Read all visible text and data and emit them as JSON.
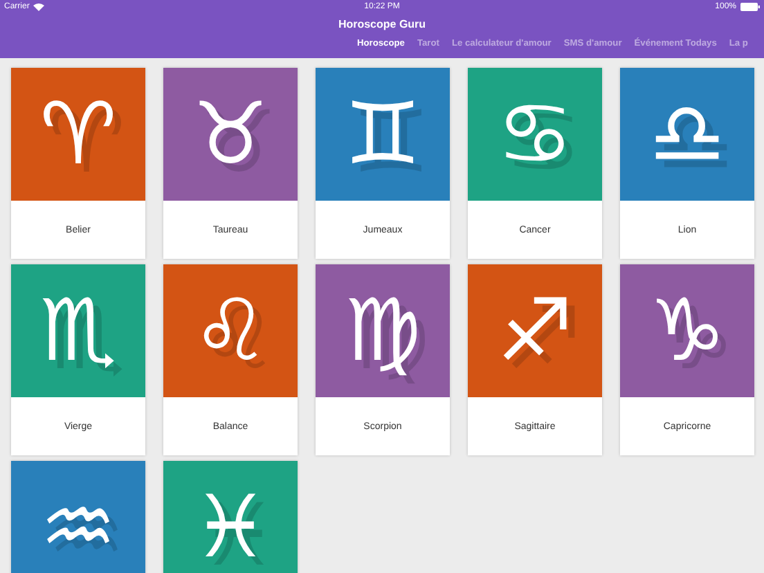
{
  "status_bar": {
    "carrier": "Carrier",
    "time": "10:22 PM",
    "battery": "100%"
  },
  "app_title": "Horoscope Guru",
  "tabs": [
    {
      "label": "Horoscope",
      "selected": true
    },
    {
      "label": "Tarot",
      "selected": false
    },
    {
      "label": "Le calculateur d'amour",
      "selected": false
    },
    {
      "label": "SMS d'amour",
      "selected": false
    },
    {
      "label": "Événement Todays",
      "selected": false
    },
    {
      "label": "La p",
      "selected": false
    }
  ],
  "signs": [
    {
      "glyph": "♈",
      "label": "Belier",
      "color": "#d35414"
    },
    {
      "glyph": "♉",
      "label": "Taureau",
      "color": "#8e5ba1"
    },
    {
      "glyph": "♊",
      "label": "Jumeaux",
      "color": "#2980ba"
    },
    {
      "glyph": "♋",
      "label": "Cancer",
      "color": "#1ea384"
    },
    {
      "glyph": "♎",
      "label": "Lion",
      "color": "#2980ba"
    },
    {
      "glyph": "♏",
      "label": "Vierge",
      "color": "#1ea384"
    },
    {
      "glyph": "♌",
      "label": "Balance",
      "color": "#d35414"
    },
    {
      "glyph": "♍",
      "label": "Scorpion",
      "color": "#8e5ba1"
    },
    {
      "glyph": "♐",
      "label": "Sagittaire",
      "color": "#d35414"
    },
    {
      "glyph": "♑",
      "label": "Capricorne",
      "color": "#8e5ba1"
    },
    {
      "glyph": "♒",
      "color": "#2980ba"
    },
    {
      "glyph": "♓",
      "color": "#1ea384"
    }
  ]
}
